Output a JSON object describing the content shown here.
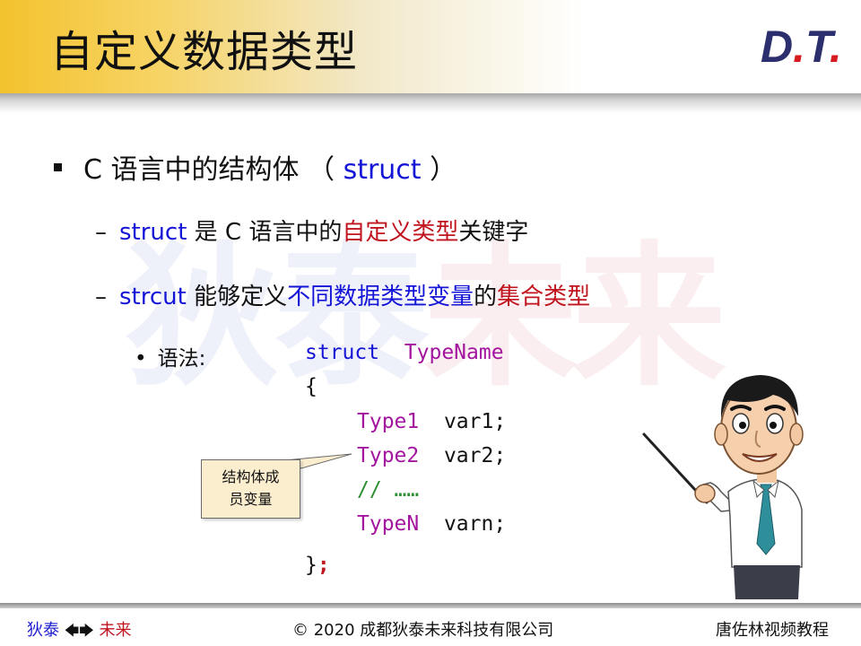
{
  "header": {
    "title": "自定义数据类型",
    "logo_main": "D",
    "logo_dot1": ".",
    "logo_t": "T",
    "logo_dot2": "."
  },
  "watermark": {
    "part1": "狄泰",
    "part2": "未来"
  },
  "content": {
    "bullet1": {
      "prefix": "C 语言中的结构体 （ ",
      "keyword": "struct",
      "suffix": " ）"
    },
    "dash1": {
      "dash": "–",
      "keyword": "struct",
      "text1": " 是 C 语言中的",
      "highlight": "自定义类型",
      "text2": "关键字"
    },
    "dash2": {
      "dash": "–",
      "keyword": "strcut",
      "text1": " 能够定义",
      "highlight1": "不同数据类型变量",
      "text2": "的",
      "highlight2": "集合类型"
    },
    "syntax": {
      "dot": "•",
      "label": "语法:"
    }
  },
  "code": {
    "struct_kw": "struct",
    "type_name": "TypeName",
    "open_brace": "{",
    "type1": "Type1",
    "var1": "var1;",
    "type2": "Type2",
    "var2": "var2;",
    "comment": "// ……",
    "typeN": "TypeN",
    "varN": "varn;",
    "close_brace": "}",
    "semicolon": ";"
  },
  "callout": {
    "line1": "结构体成",
    "line2": "员变量"
  },
  "footer": {
    "left_blue": "狄泰",
    "left_arrows": "🡄🡆",
    "left_red": "未来",
    "center": "© 2020 成都狄泰未来科技有限公司",
    "right": "唐佐林视频教程"
  },
  "colors": {
    "keyword_blue": "#1515d8",
    "highlight_red": "#c0141e",
    "code_type_magenta": "#a3159e",
    "comment_green": "#2d8f32",
    "header_gold": "#f3c22e",
    "logo_navy": "#2b2f6d"
  }
}
